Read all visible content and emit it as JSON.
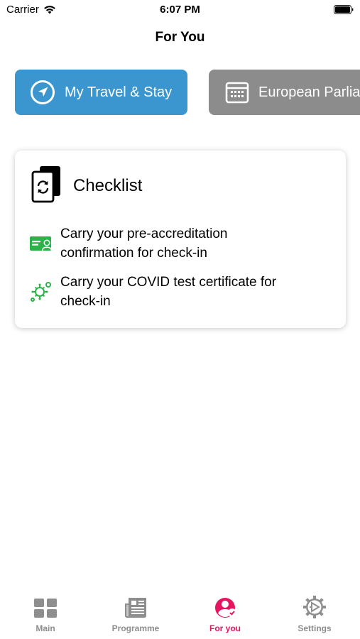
{
  "status_bar": {
    "carrier": "Carrier",
    "time": "6:07 PM",
    "wifi_icon": "wifi-icon",
    "battery_icon": "battery-icon"
  },
  "nav": {
    "title": "For You"
  },
  "chips": [
    {
      "label": "My Travel & Stay",
      "icon": "navigation-arrow-icon",
      "color": "#3b96cf"
    },
    {
      "label": "European Parlia",
      "icon": "calendar-icon",
      "color": "#8c8c8c"
    }
  ],
  "checklist": {
    "title": "Checklist",
    "icon": "documents-refresh-icon",
    "items": [
      {
        "text_line1": "Carry your pre-accreditation",
        "text_line2": "confirmation for check-in",
        "icon": "id-card-icon",
        "icon_color": "#2bb34a"
      },
      {
        "text_line1": "Carry your COVID test certificate for",
        "text_line2": "check-in",
        "icon": "virus-icon",
        "icon_color": "#2bb34a"
      }
    ]
  },
  "tab_bar": {
    "tabs": [
      {
        "label": "Main",
        "icon": "grid-icon",
        "active": false
      },
      {
        "label": "Programme",
        "icon": "newspaper-icon",
        "active": false
      },
      {
        "label": "For you",
        "icon": "user-circle-icon",
        "active": true
      },
      {
        "label": "Settings",
        "icon": "gear-icon",
        "active": false
      }
    ],
    "active_color": "#e5155f",
    "inactive_color": "#8e8e8e"
  }
}
